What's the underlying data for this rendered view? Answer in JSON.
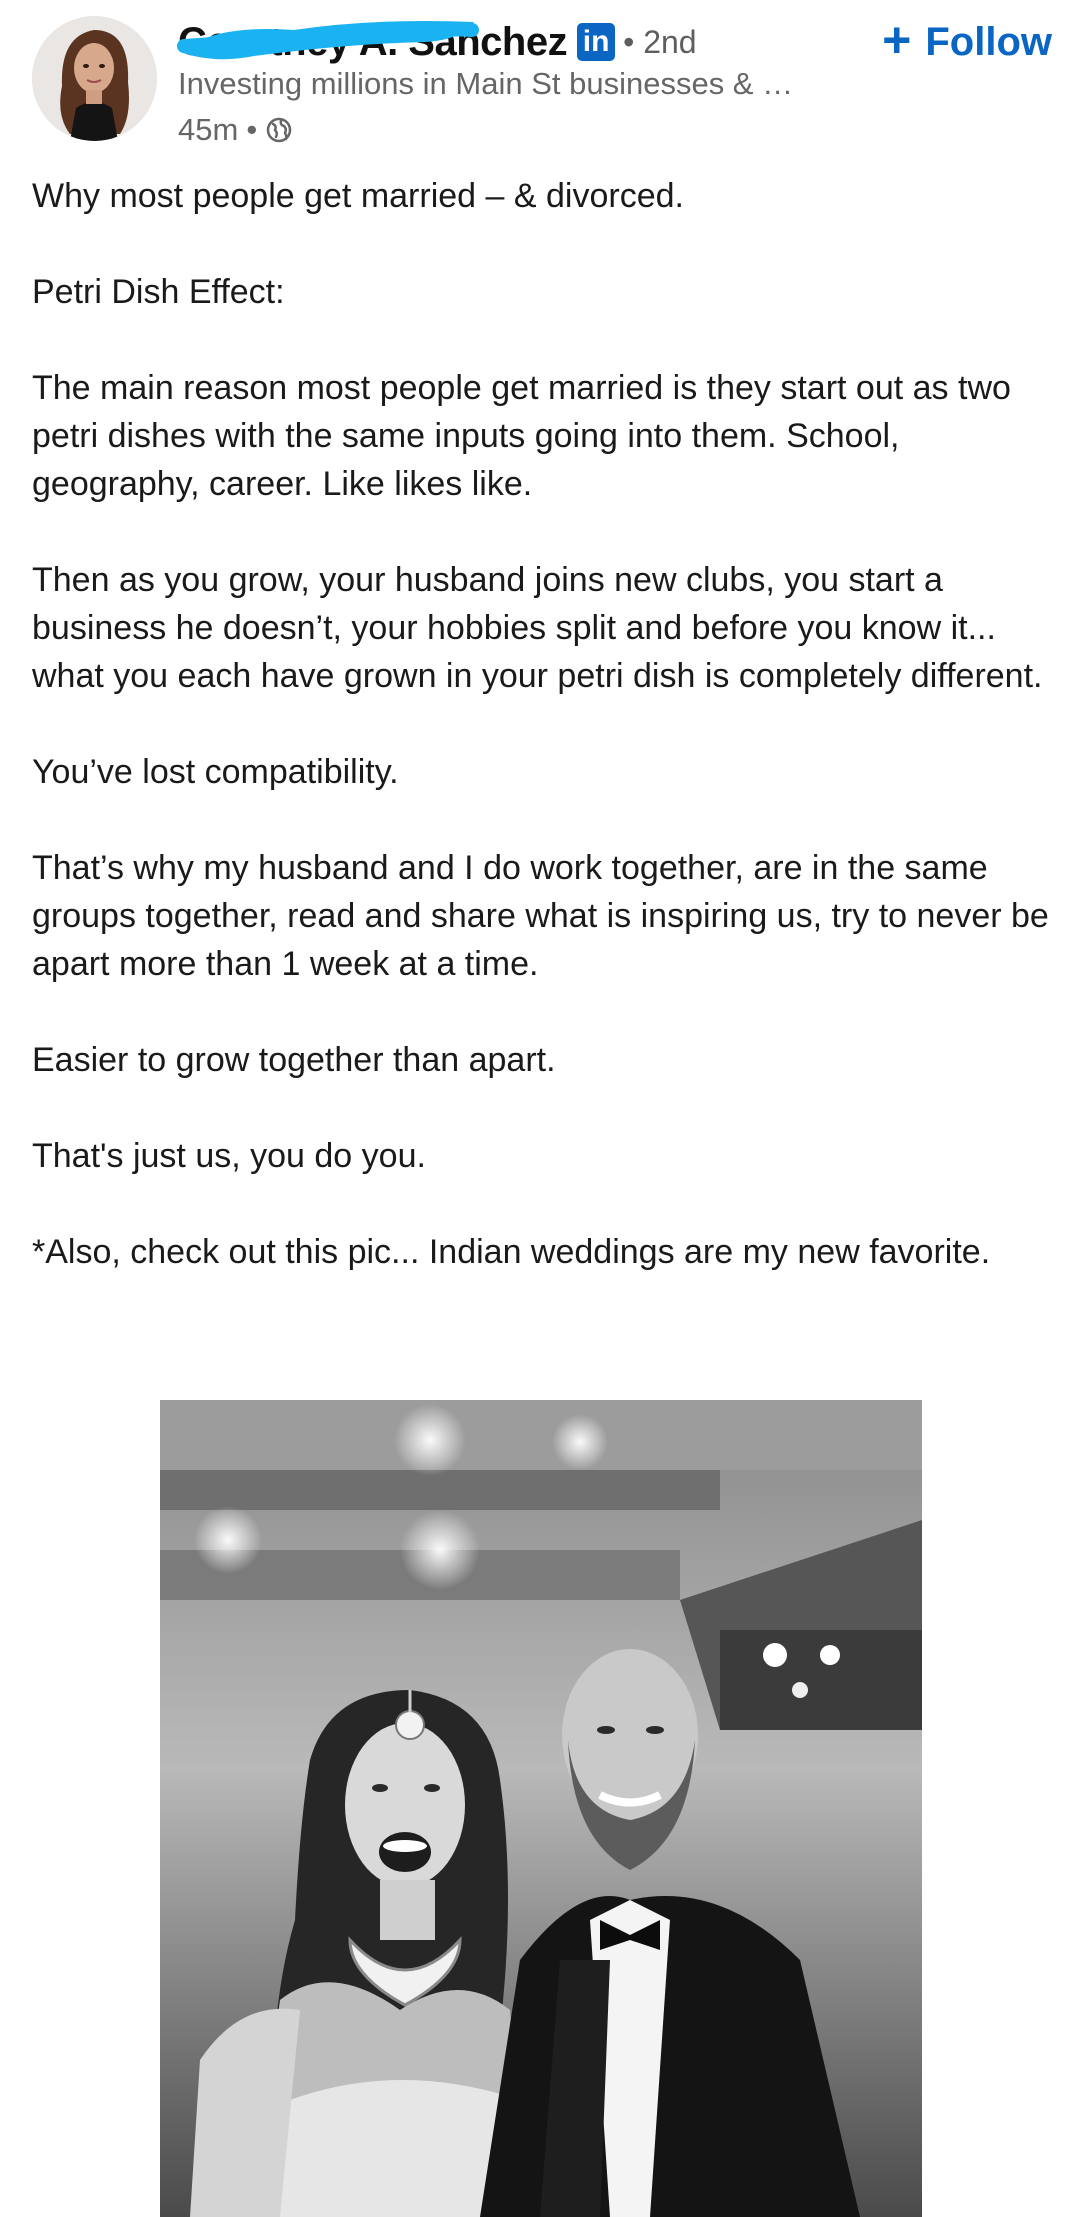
{
  "author": {
    "name": "Courtney A. Sanchez",
    "linkedin_badge": "in",
    "degree": "• 2nd",
    "headline": "Investing millions in Main St businesses & …",
    "time": "45m",
    "visibility_icon": "globe-icon"
  },
  "follow": {
    "icon": "plus-icon",
    "label": "Follow"
  },
  "post": {
    "paragraphs": [
      "Why most people get married – & divorced.",
      "Petri Dish Effect:",
      "The main reason most people get married is they start out as two petri dishes with the same inputs going into them. School, geography, career. Like likes like.",
      "Then as you grow, your husband joins new clubs, you start a business he doesn’t, your hobbies split and before you know it... what you each have grown in your petri dish is completely different.",
      "You’ve lost compatibility.",
      "That’s why my husband and I do work together, are in the same groups together, read and share what is inspiring us, try to never be apart more than 1 week at a time.",
      "Easier to grow together than apart.",
      "That's just us, you do you.",
      "*Also, check out this pic... Indian weddings are my new favorite."
    ]
  },
  "colors": {
    "accent": "#0a66c2",
    "redaction": "#1ab2f0",
    "text": "#1a1a1a",
    "muted": "#666666"
  }
}
